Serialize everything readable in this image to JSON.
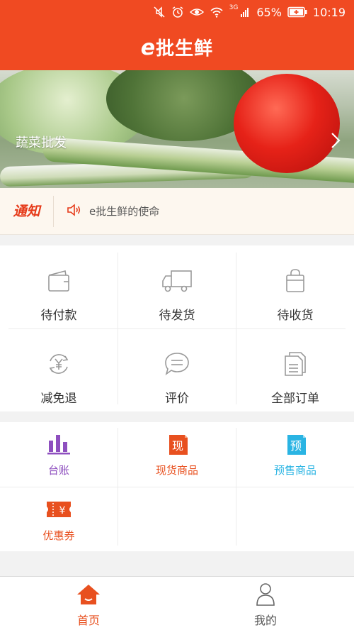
{
  "status_bar": {
    "network_label": "3G",
    "battery_percent": "65%",
    "time": "10:19"
  },
  "header": {
    "logo_e": "e",
    "logo_pi": "批",
    "logo_text": "生鲜"
  },
  "banner": {
    "title": "蔬菜批发"
  },
  "notice": {
    "tag": "通知",
    "message": "e批生鲜的使命"
  },
  "orders": {
    "items": [
      {
        "label": "待付款",
        "icon": "wallet-icon"
      },
      {
        "label": "待发货",
        "icon": "truck-icon"
      },
      {
        "label": "待收货",
        "icon": "bag-icon"
      },
      {
        "label": "减免退",
        "icon": "yuan-refresh-icon"
      },
      {
        "label": "评价",
        "icon": "chat-icon"
      },
      {
        "label": "全部订单",
        "icon": "documents-icon"
      }
    ]
  },
  "goods": {
    "items": [
      {
        "label": "台账",
        "icon": "bar-chart-icon",
        "color": "#8e4fbf"
      },
      {
        "label": "现货商品",
        "icon": "spot-goods-icon",
        "color": "#e8501f",
        "badge": "现"
      },
      {
        "label": "预售商品",
        "icon": "presale-icon",
        "color": "#2ab4e3",
        "badge": "预"
      },
      {
        "label": "优惠券",
        "icon": "coupon-icon",
        "color": "#e8501f",
        "badge": "¥"
      }
    ]
  },
  "tabbar": {
    "items": [
      {
        "label": "首页",
        "icon": "home-icon",
        "active": true,
        "color": "#e8501f"
      },
      {
        "label": "我的",
        "icon": "person-icon",
        "active": false,
        "color": "#555555"
      }
    ]
  },
  "colors": {
    "brand": "#f04a22",
    "notice_bg": "#fdf7ef",
    "page_bg": "#f2f2f2"
  }
}
